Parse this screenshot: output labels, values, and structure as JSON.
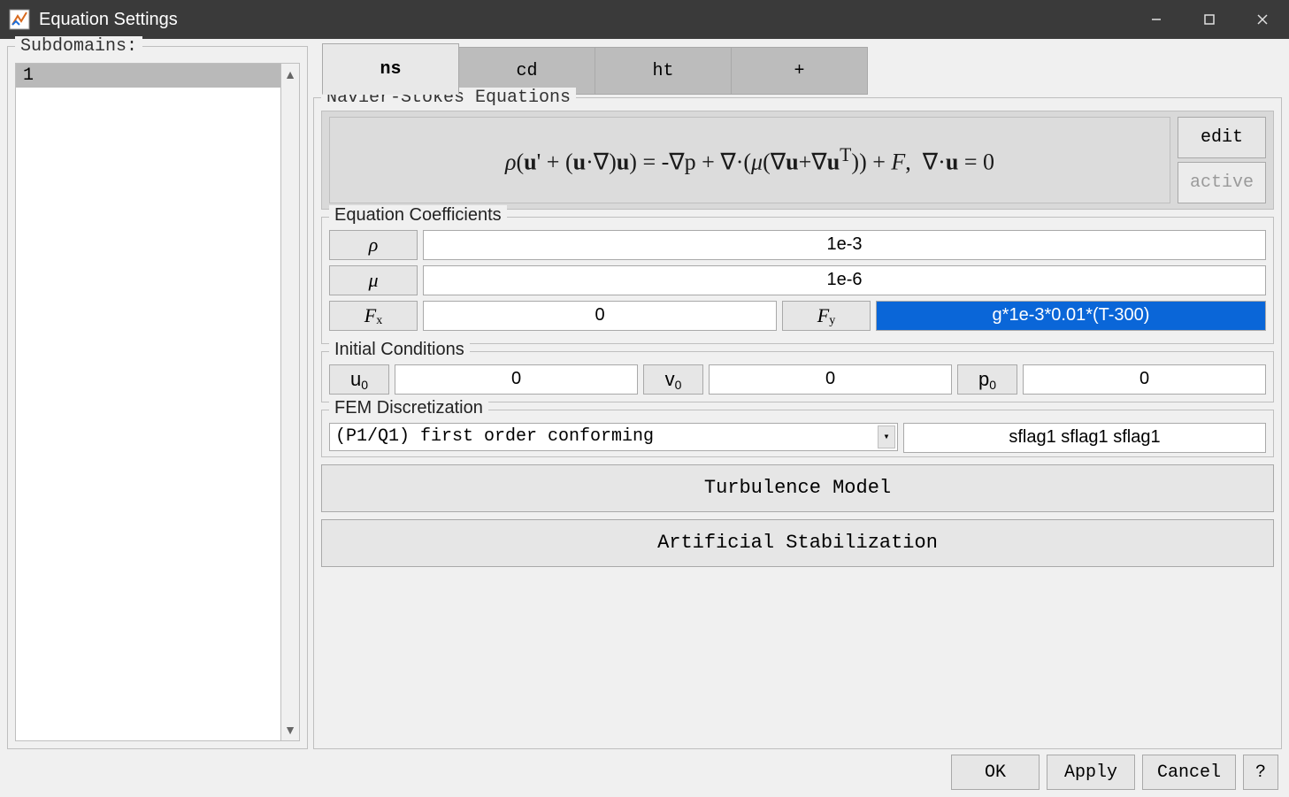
{
  "window": {
    "title": "Equation Settings"
  },
  "subdomains": {
    "legend": "Subdomains:",
    "items": [
      "1"
    ],
    "selected_index": 0
  },
  "tabs": [
    {
      "label": "ns",
      "active": true
    },
    {
      "label": "cd",
      "active": false
    },
    {
      "label": "ht",
      "active": false
    },
    {
      "label": "+",
      "active": false
    }
  ],
  "equation_group": {
    "legend": "Navier-Stokes Equations",
    "equation_text": "ρ(u' + (u·∇)u) = -∇p + ∇·(μ(∇u+∇uᵀ)) + F,  ∇·u = 0",
    "edit_label": "edit",
    "active_label": "active"
  },
  "coefficients": {
    "legend": "Equation Coefficients",
    "rho_label": "ρ",
    "rho_value": "1e-3",
    "mu_label": "μ",
    "mu_value": "1e-6",
    "fx_label_main": "F",
    "fx_label_sub": "x",
    "fx_value": "0",
    "fy_label_main": "F",
    "fy_label_sub": "y",
    "fy_value": "g*1e-3*0.01*(T-300)"
  },
  "initial": {
    "legend": "Initial Conditions",
    "u0_label_main": "u",
    "u0_label_sub": "0",
    "u0_value": "0",
    "v0_label_main": "v",
    "v0_label_sub": "0",
    "v0_value": "0",
    "p0_label_main": "p",
    "p0_label_sub": "0",
    "p0_value": "0"
  },
  "fem": {
    "legend": "FEM Discretization",
    "select_value": "(P1/Q1) first order conforming",
    "sflag_value": "sflag1 sflag1 sflag1"
  },
  "big_buttons": {
    "turbulence": "Turbulence Model",
    "stabilization": "Artificial Stabilization"
  },
  "footer": {
    "ok": "OK",
    "apply": "Apply",
    "cancel": "Cancel",
    "help": "?"
  }
}
